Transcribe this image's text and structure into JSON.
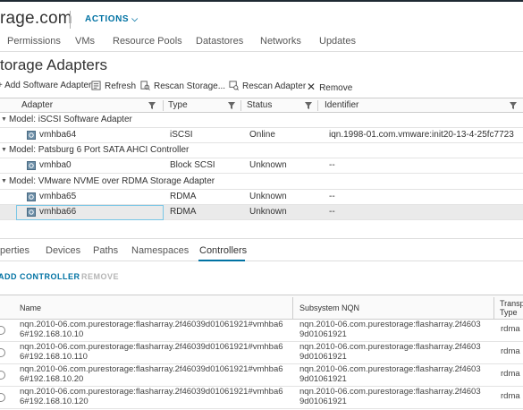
{
  "header": {
    "host_title": "rage.com",
    "actions_label": "ACTIONS"
  },
  "nav_tabs": [
    {
      "label": "Permissions"
    },
    {
      "label": "VMs"
    },
    {
      "label": "Resource Pools"
    },
    {
      "label": "Datastores"
    },
    {
      "label": "Networks"
    },
    {
      "label": "Updates"
    }
  ],
  "page_title": "torage Adapters",
  "toolbar": {
    "add_software_adapter": "Add Software Adapter",
    "refresh": "Refresh",
    "rescan_storage": "Rescan Storage...",
    "rescan_adapter": "Rescan Adapter",
    "remove": "Remove"
  },
  "adapters_table": {
    "columns": [
      "Adapter",
      "Type",
      "Status",
      "Identifier"
    ],
    "groups": [
      {
        "label": "Model: iSCSI Software Adapter",
        "rows": [
          {
            "adapter": "vmhba64",
            "type": "iSCSI",
            "status": "Online",
            "identifier": "iqn.1998-01.com.vmware:init20-13-4-25fc7723"
          }
        ]
      },
      {
        "label": "Model: Patsburg 6 Port SATA AHCI Controller",
        "rows": [
          {
            "adapter": "vmhba0",
            "type": "Block SCSI",
            "status": "Unknown",
            "identifier": "--"
          }
        ]
      },
      {
        "label": "Model: VMware NVME over RDMA Storage Adapter",
        "rows": [
          {
            "adapter": "vmhba65",
            "type": "RDMA",
            "status": "Unknown",
            "identifier": "--"
          },
          {
            "adapter": "vmhba66",
            "type": "RDMA",
            "status": "Unknown",
            "identifier": "--"
          }
        ]
      }
    ]
  },
  "sub_tabs": [
    {
      "label": "perties"
    },
    {
      "label": "Devices"
    },
    {
      "label": "Paths"
    },
    {
      "label": "Namespaces"
    },
    {
      "label": "Controllers"
    }
  ],
  "controller_actions": {
    "add": "ADD CONTROLLER",
    "remove": "REMOVE"
  },
  "controllers_table": {
    "columns": {
      "name": "Name",
      "nqn": "Subsystem NQN",
      "transport_line1": "Transp",
      "transport_line2": "Type"
    },
    "rows": [
      {
        "name1": "nqn.2010-06.com.purestorage:flasharray.2f46039d01061921#vmhba6",
        "name2": "6#192.168.10.10",
        "nqn1": "nqn.2010-06.com.purestorage:flasharray.2f4603",
        "nqn2": "9d01061921",
        "transport": "rdma"
      },
      {
        "name1": "nqn.2010-06.com.purestorage:flasharray.2f46039d01061921#vmhba6",
        "name2": "6#192.168.10.110",
        "nqn1": "nqn.2010-06.com.purestorage:flasharray.2f4603",
        "nqn2": "9d01061921",
        "transport": "rdma"
      },
      {
        "name1": "nqn.2010-06.com.purestorage:flasharray.2f46039d01061921#vmhba6",
        "name2": "6#192.168.10.20",
        "nqn1": "nqn.2010-06.com.purestorage:flasharray.2f4603",
        "nqn2": "9d01061921",
        "transport": "rdma"
      },
      {
        "name1": "nqn.2010-06.com.purestorage:flasharray.2f46039d01061921#vmhba6",
        "name2": "6#192.168.10.120",
        "nqn1": "nqn.2010-06.com.purestorage:flasharray.2f4603",
        "nqn2": "9d01061921",
        "transport": "rdma"
      }
    ]
  },
  "colors": {
    "accent": "#0072a3",
    "disabled": "#b5b5b5",
    "selection_border": "#79c6e6"
  }
}
